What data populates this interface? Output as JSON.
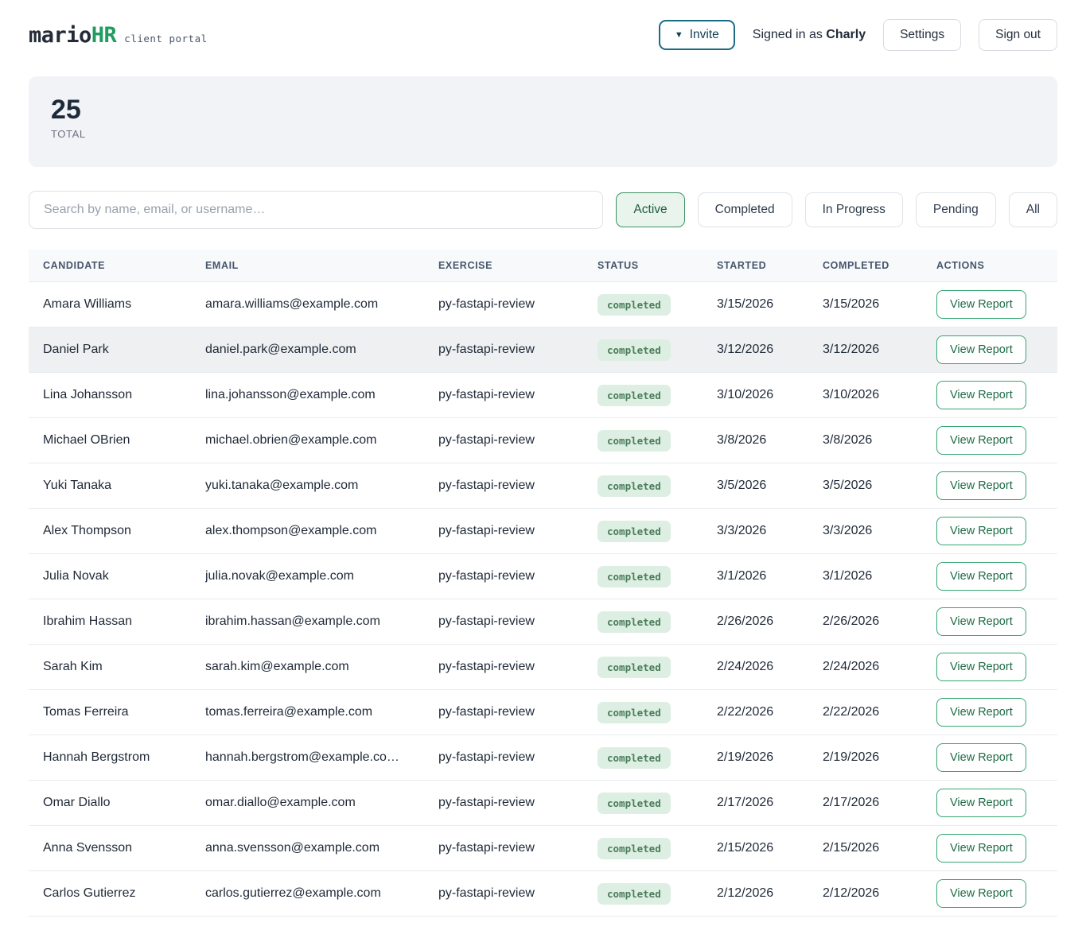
{
  "colors": {
    "accent_green": "#1f9d61",
    "badge_bg": "#ddeee3",
    "badge_text": "#4a7c59",
    "active_filter_bg": "#e9f4ed",
    "invite_border": "#1c6b85"
  },
  "header": {
    "logo_primary": "mario",
    "logo_accent": "HR",
    "logo_subtitle": "client portal",
    "invite_caret": "▼",
    "invite_label": "Invite",
    "signed_in_prefix": "Signed in as",
    "signed_in_user": "Charly",
    "settings_label": "Settings",
    "signout_label": "Sign out"
  },
  "stats": {
    "total_value": "25",
    "total_label": "TOTAL"
  },
  "search": {
    "placeholder": "Search by name, email, or username…"
  },
  "filters": [
    {
      "label": "Active",
      "active": true
    },
    {
      "label": "Completed",
      "active": false
    },
    {
      "label": "In Progress",
      "active": false
    },
    {
      "label": "Pending",
      "active": false
    },
    {
      "label": "All",
      "active": false
    }
  ],
  "table": {
    "headers": [
      "CANDIDATE",
      "EMAIL",
      "EXERCISE",
      "STATUS",
      "STARTED",
      "COMPLETED",
      "ACTIONS"
    ],
    "view_report_label": "View Report",
    "rows": [
      {
        "candidate": "Amara Williams",
        "email": "amara.williams@example.com",
        "exercise": "py-fastapi-review",
        "status": "completed",
        "started": "3/15/2026",
        "completed": "3/15/2026",
        "highlighted": false
      },
      {
        "candidate": "Daniel Park",
        "email": "daniel.park@example.com",
        "exercise": "py-fastapi-review",
        "status": "completed",
        "started": "3/12/2026",
        "completed": "3/12/2026",
        "highlighted": true
      },
      {
        "candidate": "Lina Johansson",
        "email": "lina.johansson@example.com",
        "exercise": "py-fastapi-review",
        "status": "completed",
        "started": "3/10/2026",
        "completed": "3/10/2026",
        "highlighted": false
      },
      {
        "candidate": "Michael OBrien",
        "email": "michael.obrien@example.com",
        "exercise": "py-fastapi-review",
        "status": "completed",
        "started": "3/8/2026",
        "completed": "3/8/2026",
        "highlighted": false
      },
      {
        "candidate": "Yuki Tanaka",
        "email": "yuki.tanaka@example.com",
        "exercise": "py-fastapi-review",
        "status": "completed",
        "started": "3/5/2026",
        "completed": "3/5/2026",
        "highlighted": false
      },
      {
        "candidate": "Alex Thompson",
        "email": "alex.thompson@example.com",
        "exercise": "py-fastapi-review",
        "status": "completed",
        "started": "3/3/2026",
        "completed": "3/3/2026",
        "highlighted": false
      },
      {
        "candidate": "Julia Novak",
        "email": "julia.novak@example.com",
        "exercise": "py-fastapi-review",
        "status": "completed",
        "started": "3/1/2026",
        "completed": "3/1/2026",
        "highlighted": false
      },
      {
        "candidate": "Ibrahim Hassan",
        "email": "ibrahim.hassan@example.com",
        "exercise": "py-fastapi-review",
        "status": "completed",
        "started": "2/26/2026",
        "completed": "2/26/2026",
        "highlighted": false
      },
      {
        "candidate": "Sarah Kim",
        "email": "sarah.kim@example.com",
        "exercise": "py-fastapi-review",
        "status": "completed",
        "started": "2/24/2026",
        "completed": "2/24/2026",
        "highlighted": false
      },
      {
        "candidate": "Tomas Ferreira",
        "email": "tomas.ferreira@example.com",
        "exercise": "py-fastapi-review",
        "status": "completed",
        "started": "2/22/2026",
        "completed": "2/22/2026",
        "highlighted": false
      },
      {
        "candidate": "Hannah Bergstrom",
        "email": "hannah.bergstrom@example.co…",
        "exercise": "py-fastapi-review",
        "status": "completed",
        "started": "2/19/2026",
        "completed": "2/19/2026",
        "highlighted": false
      },
      {
        "candidate": "Omar Diallo",
        "email": "omar.diallo@example.com",
        "exercise": "py-fastapi-review",
        "status": "completed",
        "started": "2/17/2026",
        "completed": "2/17/2026",
        "highlighted": false
      },
      {
        "candidate": "Anna Svensson",
        "email": "anna.svensson@example.com",
        "exercise": "py-fastapi-review",
        "status": "completed",
        "started": "2/15/2026",
        "completed": "2/15/2026",
        "highlighted": false
      },
      {
        "candidate": "Carlos Gutierrez",
        "email": "carlos.gutierrez@example.com",
        "exercise": "py-fastapi-review",
        "status": "completed",
        "started": "2/12/2026",
        "completed": "2/12/2026",
        "highlighted": false
      }
    ]
  }
}
